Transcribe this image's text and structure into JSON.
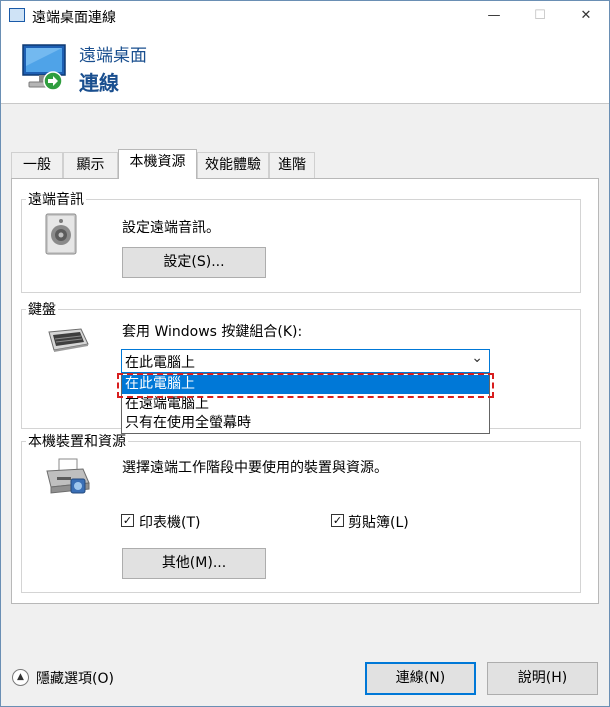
{
  "window": {
    "title": "遠端桌面連線",
    "controls": {
      "minimize": "—",
      "maximize": "☐",
      "close": "✕"
    }
  },
  "header": {
    "line1": "遠端桌面",
    "line2": "連線"
  },
  "tabs": [
    {
      "label": "一般",
      "active": false
    },
    {
      "label": "顯示",
      "active": false
    },
    {
      "label": "本機資源",
      "active": true
    },
    {
      "label": "效能體驗",
      "active": false
    },
    {
      "label": "進階",
      "active": false
    }
  ],
  "audio": {
    "legend": "遠端音訊",
    "description": "設定遠端音訊。",
    "settings_button": "設定(S)..."
  },
  "keyboard": {
    "legend": "鍵盤",
    "description": "套用 Windows 按鍵組合(K):",
    "selected": "在此電腦上",
    "options": [
      "在此電腦上",
      "在遠端電腦上",
      "只有在使用全螢幕時"
    ],
    "highlight_color": "#d81e1e"
  },
  "devices": {
    "legend": "本機裝置和資源",
    "description": "選擇遠端工作階段中要使用的裝置與資源。",
    "printers_label": "印表機(T)",
    "printers_checked": true,
    "clipboard_label": "剪貼簿(L)",
    "clipboard_checked": true,
    "more_button": "其他(M)..."
  },
  "footer": {
    "hide_options": "隱藏選項(O)",
    "connect_button": "連線(N)",
    "help_button": "說明(H)"
  },
  "icons": {
    "check": "✓",
    "chevron": "⌄",
    "collapse": "▲"
  },
  "colors": {
    "accent": "#0078d7",
    "header_text": "#1a4f8f"
  }
}
